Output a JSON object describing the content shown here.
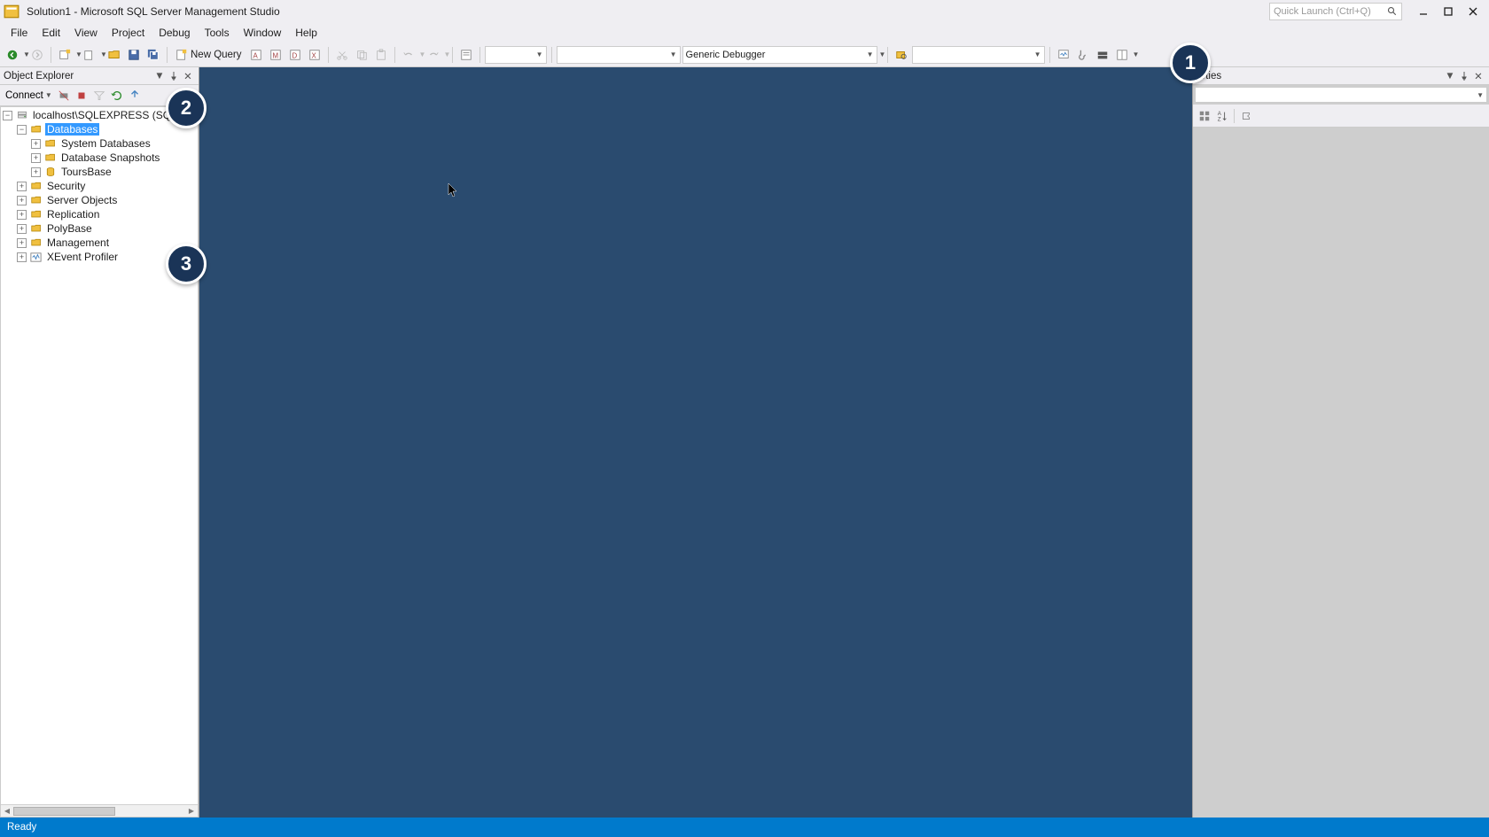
{
  "titlebar": {
    "title": "Solution1 - Microsoft SQL Server Management Studio",
    "quick_launch_placeholder": "Quick Launch (Ctrl+Q)"
  },
  "menu": {
    "file": "File",
    "edit": "Edit",
    "view": "View",
    "project": "Project",
    "debug": "Debug",
    "tools": "Tools",
    "window": "Window",
    "help": "Help"
  },
  "toolbar": {
    "new_query": "New Query",
    "debugger_combo": "Generic Debugger"
  },
  "object_explorer": {
    "panel_title": "Object Explorer",
    "connect_label": "Connect",
    "tree": {
      "server": "localhost\\SQLEXPRESS (SQL S",
      "databases": "Databases",
      "system_databases": "System Databases",
      "database_snapshots": "Database Snapshots",
      "tours_base": "ToursBase",
      "security": "Security",
      "server_objects": "Server Objects",
      "replication": "Replication",
      "polybase": "PolyBase",
      "management": "Management",
      "xevent_profiler": "XEvent Profiler"
    }
  },
  "properties": {
    "panel_title": "erties"
  },
  "statusbar": {
    "ready": "Ready"
  },
  "badges": {
    "b1": "1",
    "b2": "2",
    "b3": "3"
  }
}
